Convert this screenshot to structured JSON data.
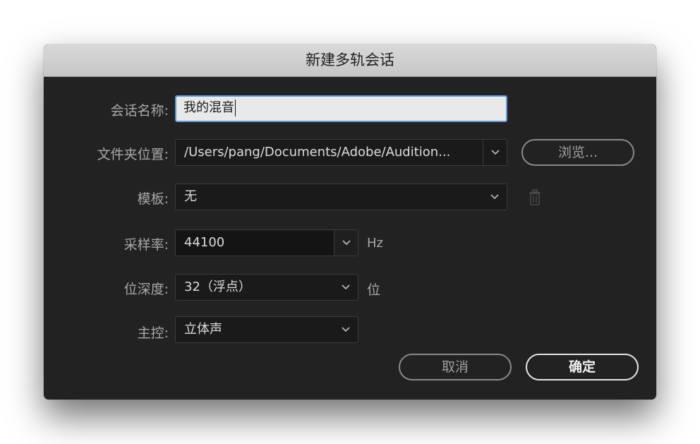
{
  "dialog": {
    "title": "新建多轨会话",
    "session_name": {
      "label": "会话名称:",
      "value": "我的混音"
    },
    "folder_location": {
      "label": "文件夹位置:",
      "value": "/Users/pang/Documents/Adobe/Audition...",
      "browse_label": "浏览..."
    },
    "template": {
      "label": "模板:",
      "value": "无"
    },
    "sample_rate": {
      "label": "采样率:",
      "value": "44100",
      "unit": "Hz"
    },
    "bit_depth": {
      "label": "位深度:",
      "value": "32（浮点）",
      "unit": "位"
    },
    "master": {
      "label": "主控:",
      "value": "立体声"
    },
    "cancel_label": "取消",
    "ok_label": "确定"
  },
  "icons": [
    "chevron-down-icon",
    "trash-icon"
  ],
  "colors": {
    "dialog_bg": "#222222",
    "titlebar_bg": "#d0d0d0",
    "focus_border": "#5b9bd5",
    "field_bg": "#1a1a1a"
  }
}
